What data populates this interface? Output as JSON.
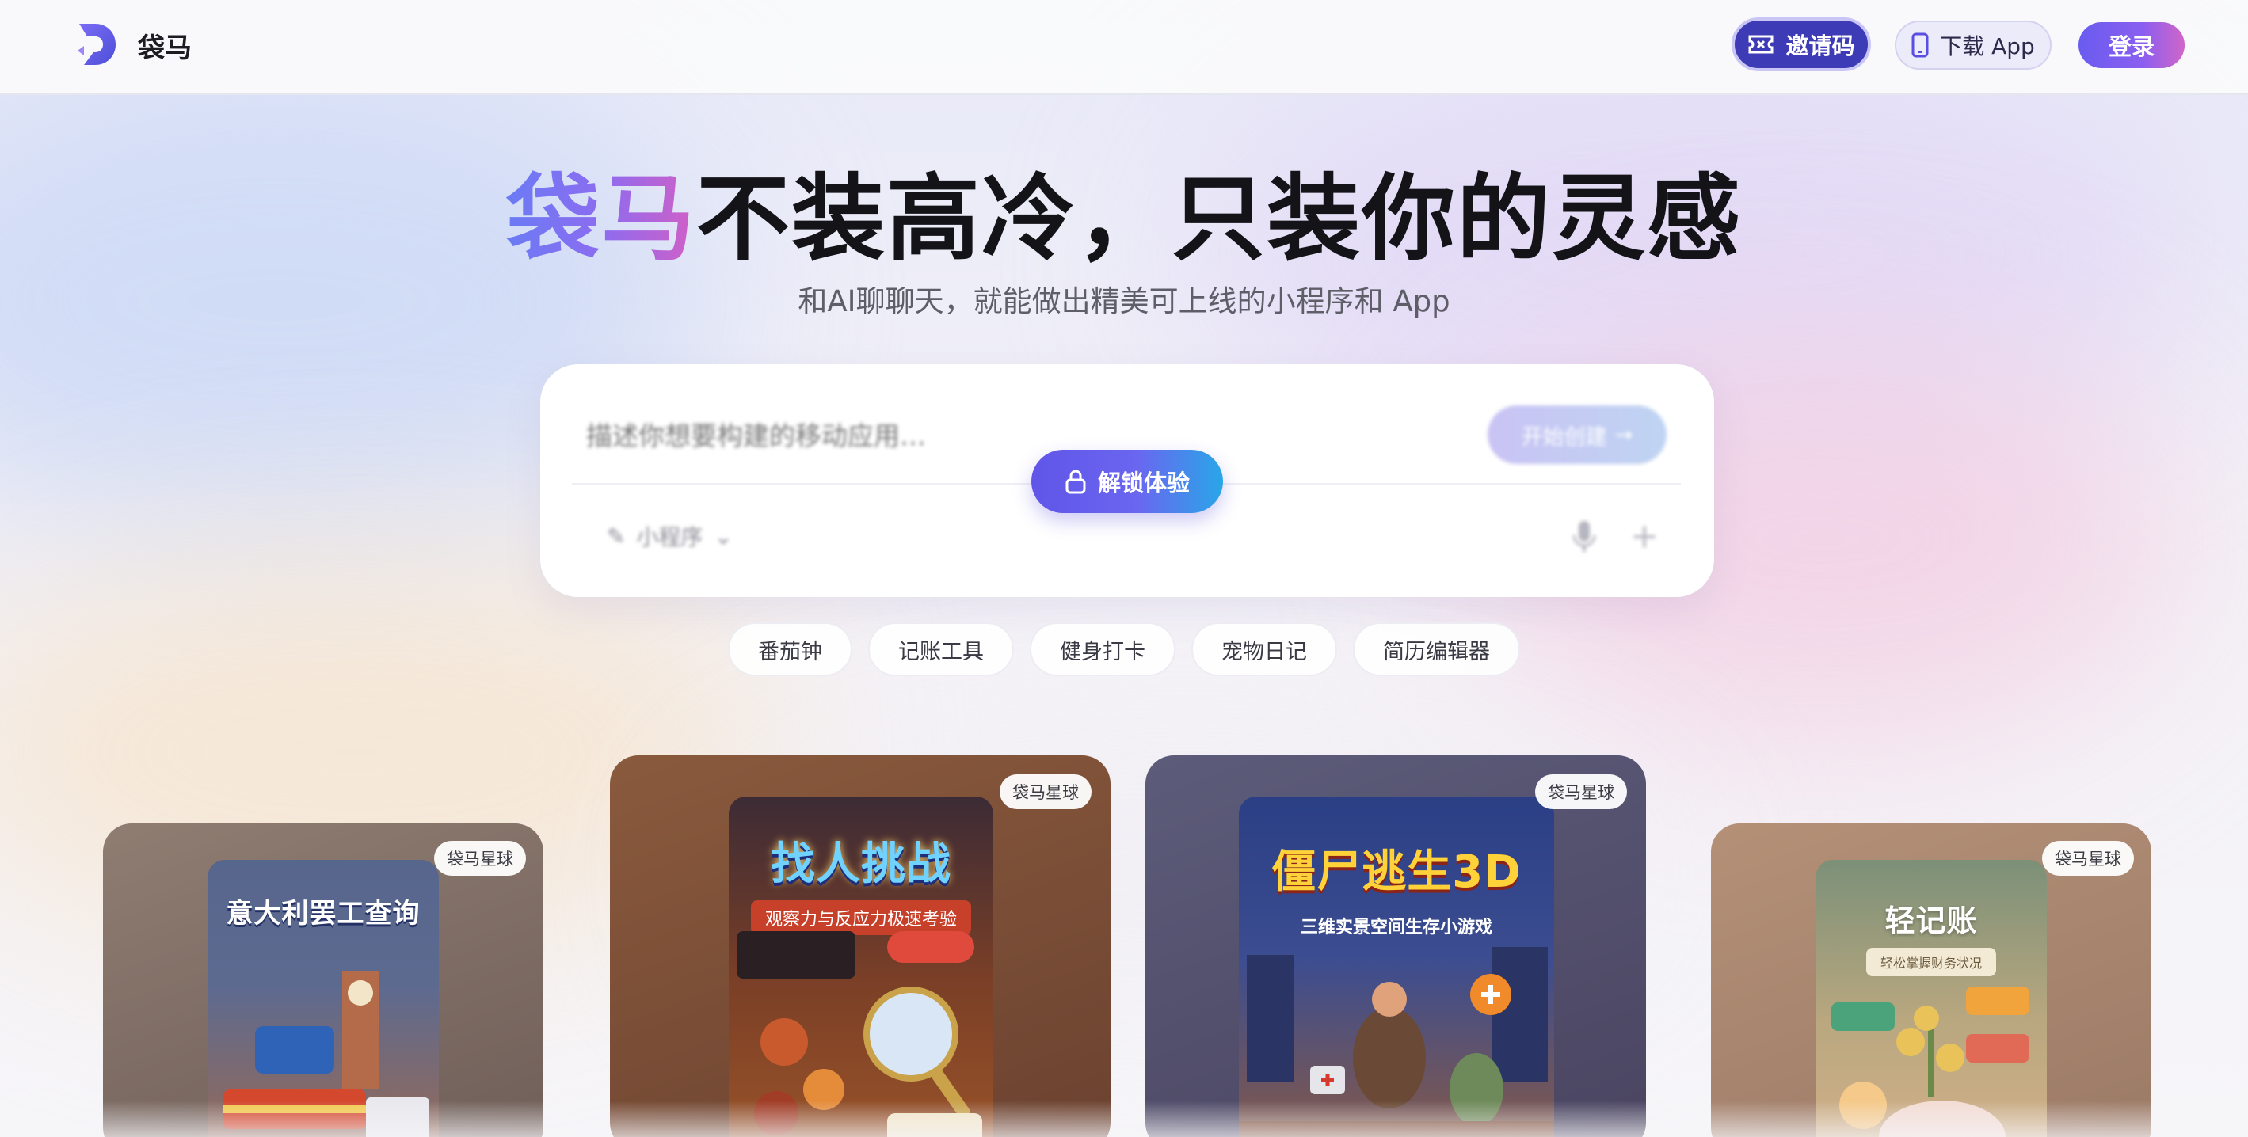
{
  "header": {
    "brand": "袋马",
    "invite_label": "邀请码",
    "download_label": "下载 App",
    "login_label": "登录"
  },
  "hero": {
    "title_accent": "袋马",
    "title_rest": "不装高冷，只装你的灵感",
    "subtitle": "和AI聊聊天，就能做出精美可上线的小程序和 App"
  },
  "prompt": {
    "placeholder": "描述你想要构建的移动应用…",
    "start_label": "开始创建",
    "app_type": "小程序",
    "unlock_label": "解锁体验"
  },
  "chips": [
    "番茄钟",
    "记账工具",
    "健身打卡",
    "宠物日记",
    "简历编辑器"
  ],
  "showcase": {
    "badge": "袋马星球",
    "cards": [
      {
        "title": "意大利罢工查询",
        "subtitle": ""
      },
      {
        "title": "找人挑战",
        "subtitle": "观察力与反应力极速考验"
      },
      {
        "title": "僵尸逃生3D",
        "subtitle": "三维实景空间生存小游戏"
      },
      {
        "title": "轻记账",
        "subtitle": "轻松掌握财务状况"
      }
    ]
  },
  "colors": {
    "brand_purple": "#6a5cf0",
    "invite_bg": "#3e3bb6",
    "accent_pink": "#d25fc6",
    "accent_blue": "#29a6e8"
  },
  "icons": {
    "logo": "daima-logo-icon",
    "invite": "ticket-icon",
    "download": "phone-icon",
    "lock": "lock-icon",
    "mic": "mic-icon",
    "plus": "plus-icon"
  }
}
